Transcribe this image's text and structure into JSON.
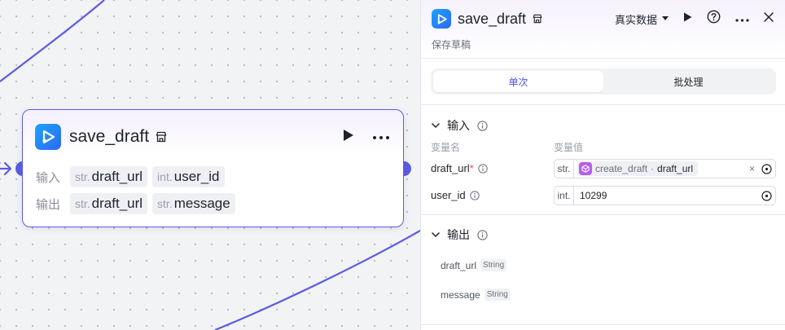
{
  "node": {
    "title": "save_draft",
    "input_label": "输入",
    "output_label": "输出",
    "inputs": [
      {
        "type": "str.",
        "name": "draft_url"
      },
      {
        "type": "int.",
        "name": "user_id"
      }
    ],
    "outputs": [
      {
        "type": "str.",
        "name": "draft_url"
      },
      {
        "type": "str.",
        "name": "message"
      }
    ]
  },
  "panel": {
    "title": "save_draft",
    "description": "保存草稿",
    "data_mode": "真实数据",
    "tabs": [
      "单次",
      "批处理"
    ],
    "input_section": "输入",
    "col_name": "变量名",
    "col_value": "变量值",
    "params": [
      {
        "name": "draft_url",
        "required_mark": "*",
        "type": "str.",
        "ref_node": "create_draft",
        "ref_sep": "·",
        "ref_var": "draft_url",
        "clear": "×"
      },
      {
        "name": "user_id",
        "type": "int.",
        "value": "10299"
      }
    ],
    "output_section": "输出",
    "outputs": [
      {
        "name": "draft_url",
        "type": "String"
      },
      {
        "name": "message",
        "type": "String"
      }
    ]
  },
  "colors": {
    "accent": "#4d53e8",
    "edge": "#5b5ce2",
    "app_icon": "#2a6af2",
    "ref_icon": "#b45ef2"
  }
}
